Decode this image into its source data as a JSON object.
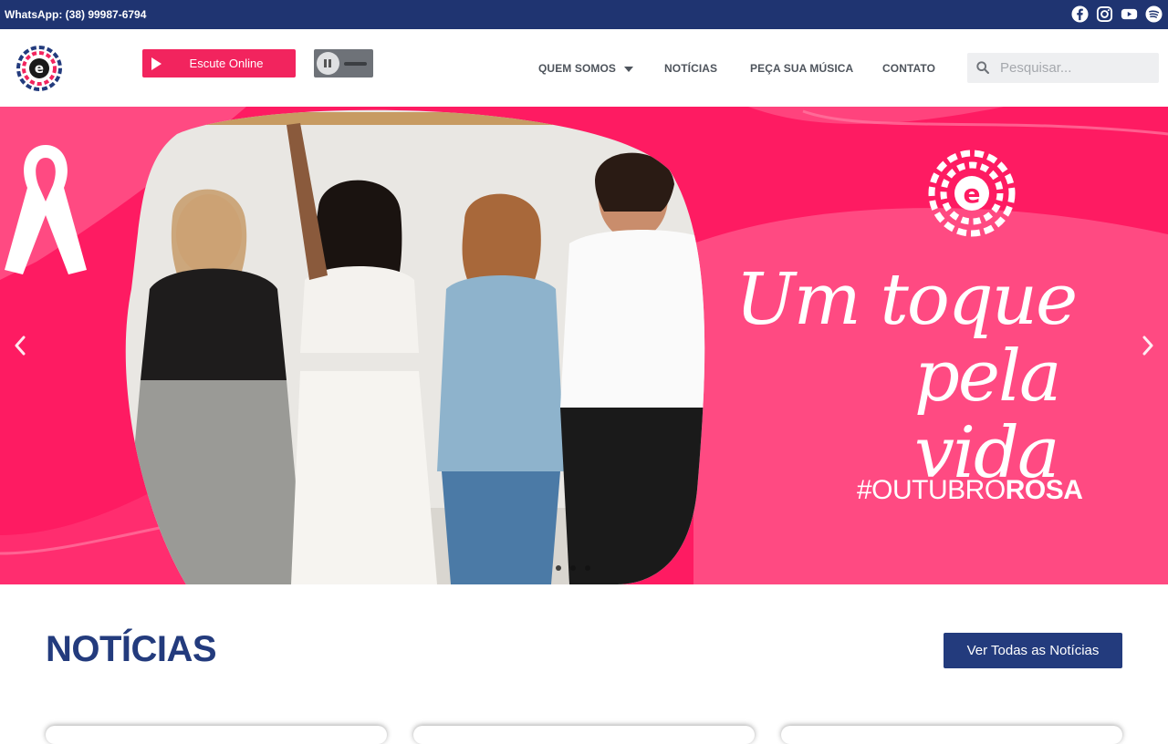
{
  "topbar": {
    "whatsapp": "WhatsApp: (38) 99987-6794",
    "socials": [
      "facebook-icon",
      "instagram-icon",
      "youtube-icon",
      "spotify-icon"
    ]
  },
  "header": {
    "listen_label": "Escute Online",
    "nav": {
      "quem_somos": "QUEM SOMOS",
      "noticias": "NOTÍCIAS",
      "peca": "PEÇA SUA MÚSICA",
      "contato": "CONTATO"
    },
    "search_placeholder": "Pesquisar..."
  },
  "hero": {
    "slogan_line1": "Um toque",
    "slogan_line2": "pela vida",
    "hashtag_prefix": "#OUTUBRO",
    "hashtag_bold": "ROSA",
    "slide_count": 3,
    "active_slide": 1
  },
  "news": {
    "title": "NOTÍCIAS",
    "all_button": "Ver Todas as Notícias"
  },
  "colors": {
    "navy": "#1f3471",
    "pink": "#fe1b62",
    "button_pink": "#f2245e",
    "title_blue": "#233b7d"
  }
}
